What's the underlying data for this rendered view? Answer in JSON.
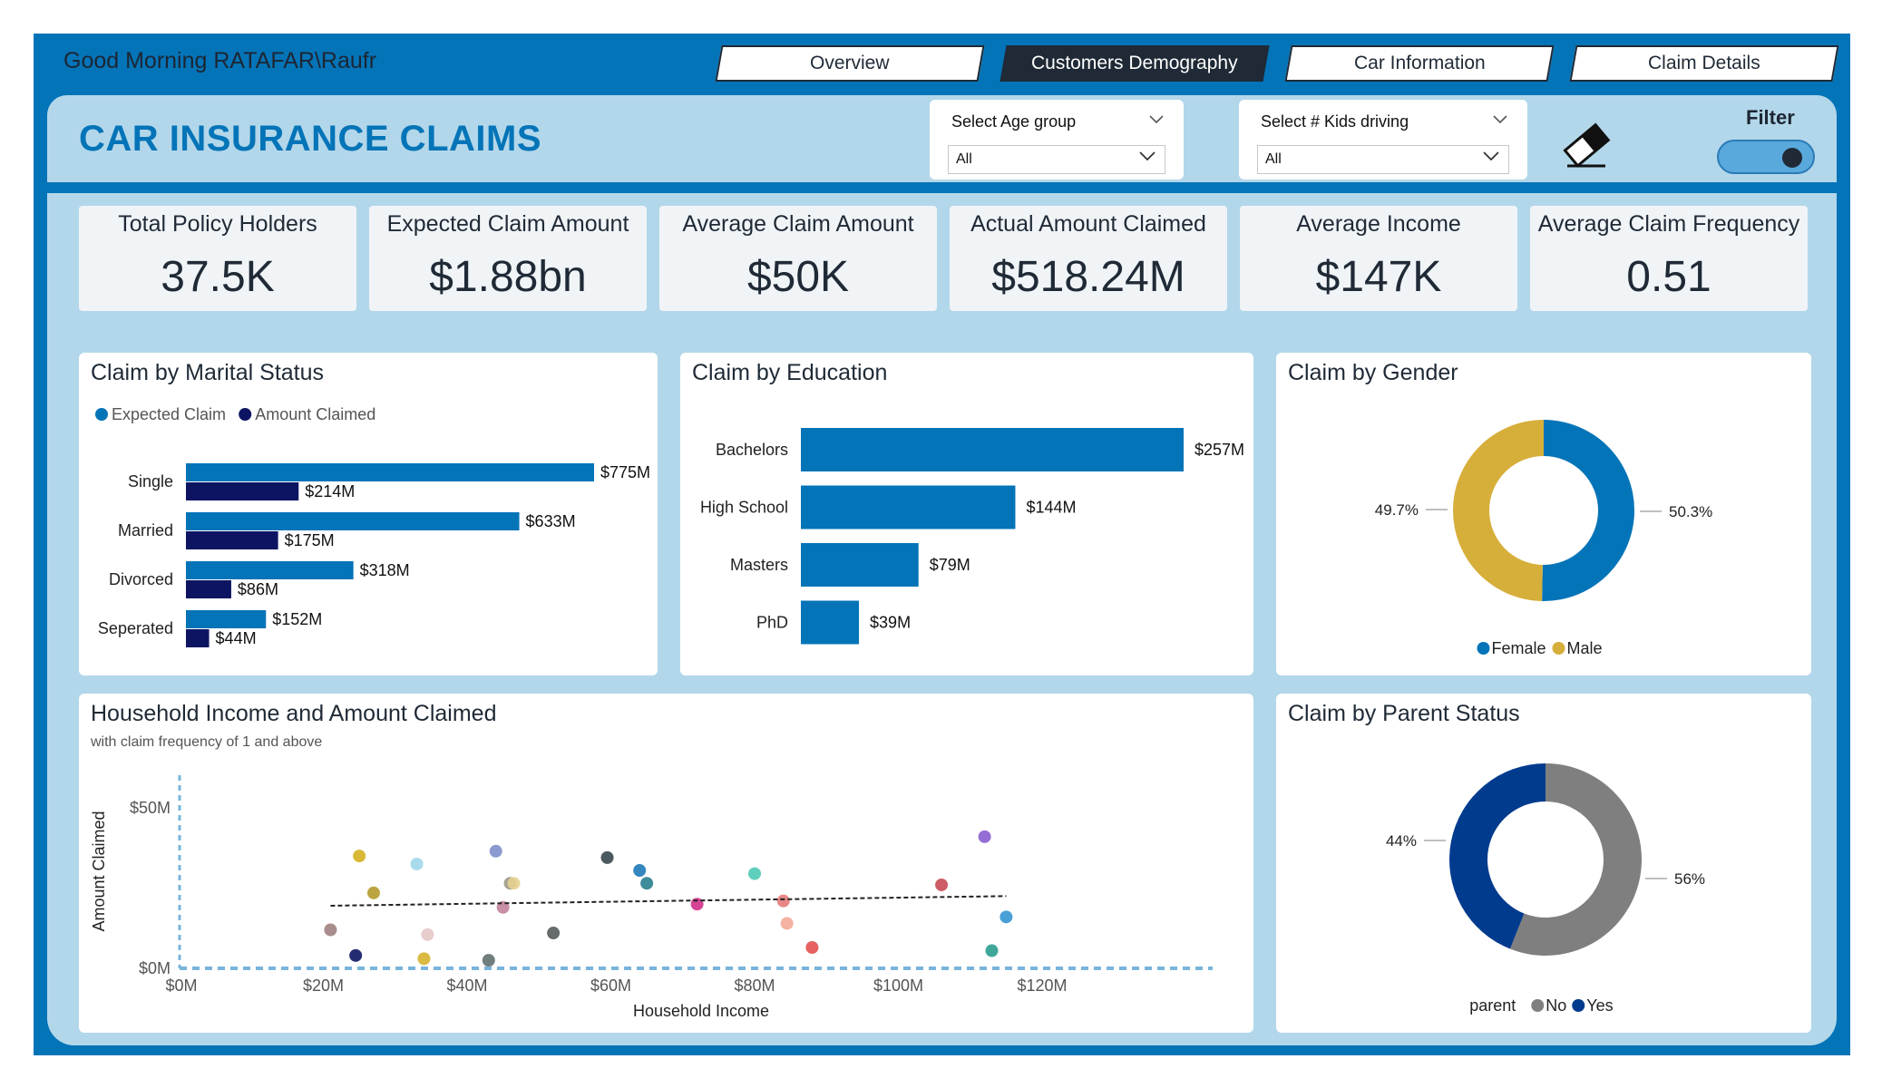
{
  "header": {
    "greeting": "Good Morning RATAFAR\\Raufr",
    "title": "CAR INSURANCE CLAIMS",
    "tabs": [
      {
        "label": "Overview",
        "active": false
      },
      {
        "label": "Customers Demography",
        "active": true
      },
      {
        "label": "Car Information",
        "active": false
      },
      {
        "label": "Claim Details",
        "active": false
      }
    ],
    "slicers": [
      {
        "label": "Select Age group",
        "value": "All"
      },
      {
        "label": "Select # Kids driving",
        "value": "All"
      }
    ],
    "filter_label": "Filter",
    "eraser_icon": "eraser-icon"
  },
  "kpis": [
    {
      "title": "Total Policy Holders",
      "value": "37.5K"
    },
    {
      "title": "Expected Claim Amount",
      "value": "$1.88bn"
    },
    {
      "title": "Average Claim Amount",
      "value": "$50K"
    },
    {
      "title": "Actual Amount Claimed",
      "value": "$518.24M"
    },
    {
      "title": "Average Income",
      "value": "$147K"
    },
    {
      "title": "Average Claim Frequency",
      "value": "0.51"
    }
  ],
  "colors": {
    "accent": "#0474b8",
    "navy": "#0d1563",
    "gold": "#d6ae3a",
    "grey": "#7f7f7f",
    "darkblue": "#003b8e",
    "panel": "#b3d7ea"
  },
  "chart_data": [
    {
      "type": "bar",
      "title": "Claim by Marital Status",
      "categories": [
        "Single",
        "Married",
        "Divorced",
        "Seperated"
      ],
      "series": [
        {
          "name": "Expected Claim",
          "values": [
            775,
            633,
            318,
            152
          ],
          "labels": [
            "$775M",
            "$633M",
            "$318M",
            "$152M"
          ],
          "color": "#0474b8"
        },
        {
          "name": "Amount Claimed",
          "values": [
            214,
            175,
            86,
            44
          ],
          "labels": [
            "$214M",
            "$175M",
            "$86M",
            "$44M"
          ],
          "color": "#0d1563"
        }
      ],
      "legend": "top-left"
    },
    {
      "type": "bar",
      "title": "Claim by Education",
      "categories": [
        "Bachelors",
        "High School",
        "Masters",
        "PhD"
      ],
      "values": [
        257,
        144,
        79,
        39
      ],
      "labels": [
        "$257M",
        "$144M",
        "$79M",
        "$39M"
      ]
    },
    {
      "type": "pie",
      "title": "Claim by Gender",
      "slices": [
        {
          "name": "Female",
          "value": 50.3,
          "label": "50.3%",
          "color": "#0474b8"
        },
        {
          "name": "Male",
          "value": 49.7,
          "label": "49.7%",
          "color": "#d6ae3a"
        }
      ],
      "legend": "bottom"
    },
    {
      "type": "scatter",
      "title": "Household Income and Amount Claimed",
      "subtitle": "with claim frequency of 1 and above",
      "xlabel": "Household Income",
      "ylabel": "Amount Claimed",
      "x_ticks": [
        "$0M",
        "$20M",
        "$40M",
        "$60M",
        "$80M",
        "$100M",
        "$120M"
      ],
      "y_ticks": [
        "$0M",
        "$50M"
      ],
      "xlim": [
        0,
        120
      ],
      "ylim": [
        0,
        50
      ],
      "trendline": {
        "x": [
          21,
          115
        ],
        "y": [
          19.5,
          22.5
        ]
      },
      "points": [
        {
          "x": 21,
          "y": 12,
          "color": "#a08080"
        },
        {
          "x": 24.5,
          "y": 4,
          "color": "#0d1563"
        },
        {
          "x": 25,
          "y": 35,
          "color": "#d4b020"
        },
        {
          "x": 27,
          "y": 23.5,
          "color": "#b59b2c"
        },
        {
          "x": 33,
          "y": 32.5,
          "color": "#9fd8ea"
        },
        {
          "x": 34,
          "y": 3,
          "color": "#d6b22d"
        },
        {
          "x": 34.5,
          "y": 10.5,
          "color": "#e6c8c8"
        },
        {
          "x": 43,
          "y": 2.5,
          "color": "#607070"
        },
        {
          "x": 44,
          "y": 36.5,
          "color": "#7e8fcb"
        },
        {
          "x": 45,
          "y": 19,
          "color": "#c2839c"
        },
        {
          "x": 46,
          "y": 26.5,
          "color": "#9a9a8a"
        },
        {
          "x": 46.5,
          "y": 26.5,
          "color": "#e8d090"
        },
        {
          "x": 52,
          "y": 11,
          "color": "#555c5c"
        },
        {
          "x": 59.5,
          "y": 34.5,
          "color": "#37474f"
        },
        {
          "x": 64,
          "y": 30.5,
          "color": "#1f7ab8"
        },
        {
          "x": 65,
          "y": 26.5,
          "color": "#2a7f8f"
        },
        {
          "x": 72,
          "y": 20,
          "color": "#d0308a"
        },
        {
          "x": 80,
          "y": 29.5,
          "color": "#4fc9b5"
        },
        {
          "x": 84,
          "y": 21,
          "color": "#e67a7a"
        },
        {
          "x": 84.5,
          "y": 14,
          "color": "#f4a898"
        },
        {
          "x": 88,
          "y": 6.5,
          "color": "#e35050"
        },
        {
          "x": 106,
          "y": 26,
          "color": "#c84a55"
        },
        {
          "x": 112,
          "y": 41,
          "color": "#8a5ed0"
        },
        {
          "x": 113,
          "y": 5.5,
          "color": "#2a9d8f"
        },
        {
          "x": 115,
          "y": 16,
          "color": "#3596d2"
        }
      ]
    },
    {
      "type": "pie",
      "title": "Claim by Parent Status",
      "legend_title": "parent",
      "slices": [
        {
          "name": "No",
          "value": 56,
          "label": "56%",
          "color": "#7f7f7f"
        },
        {
          "name": "Yes",
          "value": 44,
          "label": "44%",
          "color": "#003b8e"
        }
      ],
      "legend": "bottom"
    }
  ]
}
